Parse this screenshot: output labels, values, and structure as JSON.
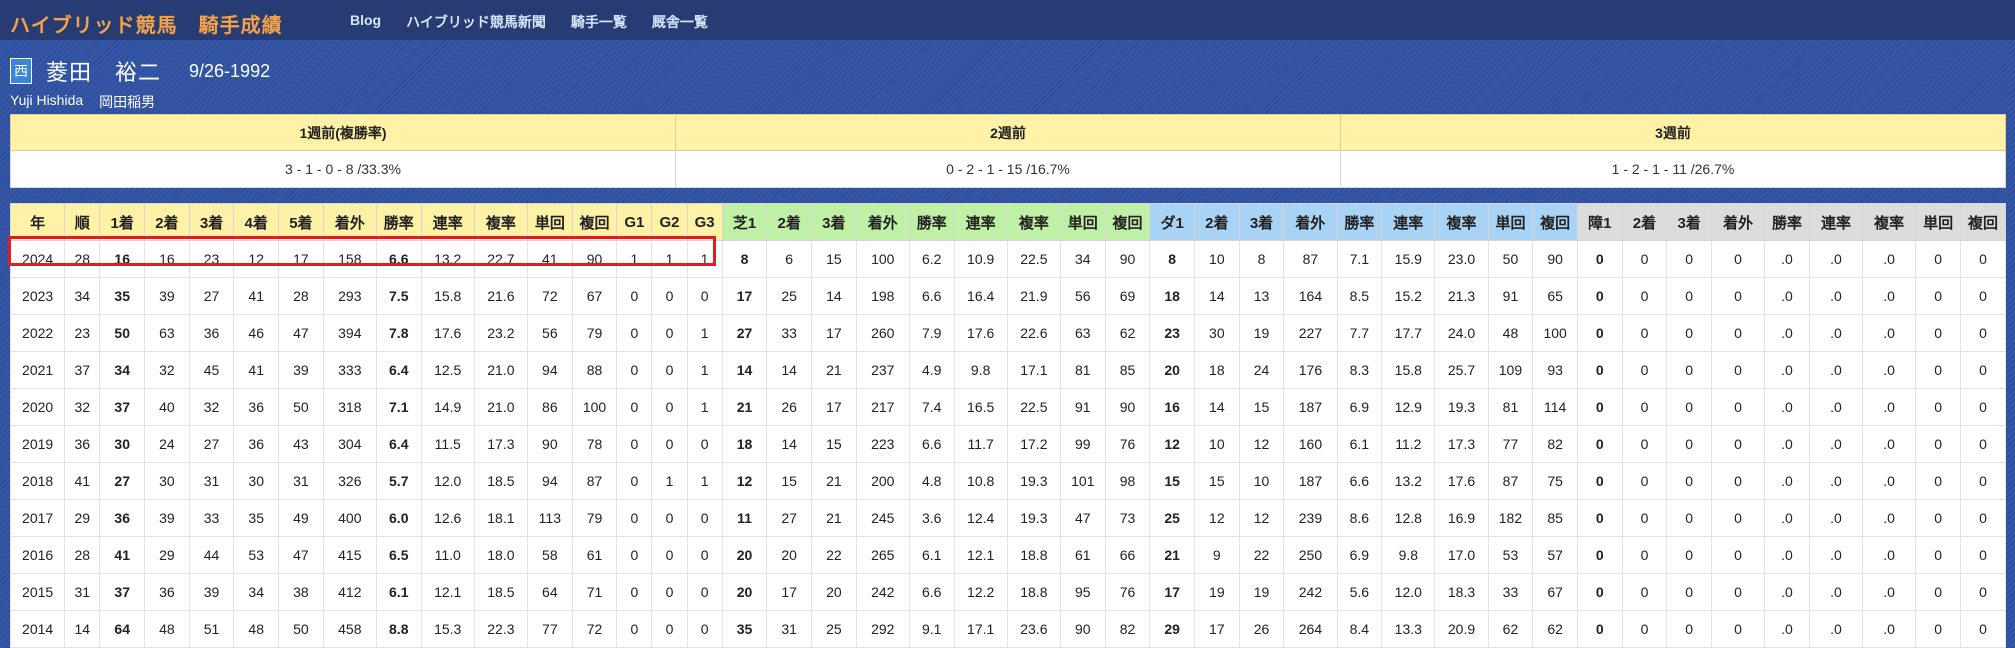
{
  "header": {
    "site_title": "ハイブリッド競馬　騎手成績",
    "nav": [
      "Blog",
      "ハイブリッド競馬新聞",
      "騎手一覧",
      "厩舎一覧"
    ]
  },
  "jockey": {
    "affiliation": "西",
    "name": "菱田　裕二",
    "dob": "9/26-1992",
    "name_en": "Yuji Hishida",
    "stable": "岡田稲男"
  },
  "weeks": {
    "headers": [
      "1週前(複勝率)",
      "2週前",
      "3週前"
    ],
    "values": [
      "3 - 1 - 0 - 8 /33.3%",
      "0 - 2 - 1 - 15 /16.7%",
      "1 - 2 - 1 - 11 /26.7%"
    ]
  },
  "stats": {
    "headers": [
      "年",
      "順",
      "1着",
      "2着",
      "3着",
      "4着",
      "5着",
      "着外",
      "勝率",
      "連率",
      "複率",
      "単回",
      "複回",
      "G1",
      "G2",
      "G3",
      "芝1",
      "2着",
      "3着",
      "着外",
      "勝率",
      "連率",
      "複率",
      "単回",
      "複回",
      "ダ1",
      "2着",
      "3着",
      "着外",
      "勝率",
      "連率",
      "複率",
      "単回",
      "複回",
      "障1",
      "2着",
      "3着",
      "着外",
      "勝率",
      "連率",
      "複率",
      "単回",
      "複回"
    ],
    "rows": [
      [
        "2024",
        "28",
        "16",
        "16",
        "23",
        "12",
        "17",
        "158",
        "6.6",
        "13.2",
        "22.7",
        "41",
        "90",
        "1",
        "1",
        "1",
        "8",
        "6",
        "15",
        "100",
        "6.2",
        "10.9",
        "22.5",
        "34",
        "90",
        "8",
        "10",
        "8",
        "87",
        "7.1",
        "15.9",
        "23.0",
        "50",
        "90",
        "0",
        "0",
        "0",
        "0",
        ".0",
        ".0",
        ".0",
        "0",
        "0"
      ],
      [
        "2023",
        "34",
        "35",
        "39",
        "27",
        "41",
        "28",
        "293",
        "7.5",
        "15.8",
        "21.6",
        "72",
        "67",
        "0",
        "0",
        "0",
        "17",
        "25",
        "14",
        "198",
        "6.6",
        "16.4",
        "21.9",
        "56",
        "69",
        "18",
        "14",
        "13",
        "164",
        "8.5",
        "15.2",
        "21.3",
        "91",
        "65",
        "0",
        "0",
        "0",
        "0",
        ".0",
        ".0",
        ".0",
        "0",
        "0"
      ],
      [
        "2022",
        "23",
        "50",
        "63",
        "36",
        "46",
        "47",
        "394",
        "7.8",
        "17.6",
        "23.2",
        "56",
        "79",
        "0",
        "0",
        "1",
        "27",
        "33",
        "17",
        "260",
        "7.9",
        "17.6",
        "22.6",
        "63",
        "62",
        "23",
        "30",
        "19",
        "227",
        "7.7",
        "17.7",
        "24.0",
        "48",
        "100",
        "0",
        "0",
        "0",
        "0",
        ".0",
        ".0",
        ".0",
        "0",
        "0"
      ],
      [
        "2021",
        "37",
        "34",
        "32",
        "45",
        "41",
        "39",
        "333",
        "6.4",
        "12.5",
        "21.0",
        "94",
        "88",
        "0",
        "0",
        "1",
        "14",
        "14",
        "21",
        "237",
        "4.9",
        "9.8",
        "17.1",
        "81",
        "85",
        "20",
        "18",
        "24",
        "176",
        "8.3",
        "15.8",
        "25.7",
        "109",
        "93",
        "0",
        "0",
        "0",
        "0",
        ".0",
        ".0",
        ".0",
        "0",
        "0"
      ],
      [
        "2020",
        "32",
        "37",
        "40",
        "32",
        "36",
        "50",
        "318",
        "7.1",
        "14.9",
        "21.0",
        "86",
        "100",
        "0",
        "0",
        "1",
        "21",
        "26",
        "17",
        "217",
        "7.4",
        "16.5",
        "22.5",
        "91",
        "90",
        "16",
        "14",
        "15",
        "187",
        "6.9",
        "12.9",
        "19.3",
        "81",
        "114",
        "0",
        "0",
        "0",
        "0",
        ".0",
        ".0",
        ".0",
        "0",
        "0"
      ],
      [
        "2019",
        "36",
        "30",
        "24",
        "27",
        "36",
        "43",
        "304",
        "6.4",
        "11.5",
        "17.3",
        "90",
        "78",
        "0",
        "0",
        "0",
        "18",
        "14",
        "15",
        "223",
        "6.6",
        "11.7",
        "17.2",
        "99",
        "76",
        "12",
        "10",
        "12",
        "160",
        "6.1",
        "11.2",
        "17.3",
        "77",
        "82",
        "0",
        "0",
        "0",
        "0",
        ".0",
        ".0",
        ".0",
        "0",
        "0"
      ],
      [
        "2018",
        "41",
        "27",
        "30",
        "31",
        "30",
        "31",
        "326",
        "5.7",
        "12.0",
        "18.5",
        "94",
        "87",
        "0",
        "1",
        "1",
        "12",
        "15",
        "21",
        "200",
        "4.8",
        "10.8",
        "19.3",
        "101",
        "98",
        "15",
        "15",
        "10",
        "187",
        "6.6",
        "13.2",
        "17.6",
        "87",
        "75",
        "0",
        "0",
        "0",
        "0",
        ".0",
        ".0",
        ".0",
        "0",
        "0"
      ],
      [
        "2017",
        "29",
        "36",
        "39",
        "33",
        "35",
        "49",
        "400",
        "6.0",
        "12.6",
        "18.1",
        "113",
        "79",
        "0",
        "0",
        "0",
        "11",
        "27",
        "21",
        "245",
        "3.6",
        "12.4",
        "19.3",
        "47",
        "73",
        "25",
        "12",
        "12",
        "239",
        "8.6",
        "12.8",
        "16.9",
        "182",
        "85",
        "0",
        "0",
        "0",
        "0",
        ".0",
        ".0",
        ".0",
        "0",
        "0"
      ],
      [
        "2016",
        "28",
        "41",
        "29",
        "44",
        "53",
        "47",
        "415",
        "6.5",
        "11.0",
        "18.0",
        "58",
        "61",
        "0",
        "0",
        "0",
        "20",
        "20",
        "22",
        "265",
        "6.1",
        "12.1",
        "18.8",
        "61",
        "66",
        "21",
        "9",
        "22",
        "250",
        "6.9",
        "9.8",
        "17.0",
        "53",
        "57",
        "0",
        "0",
        "0",
        "0",
        ".0",
        ".0",
        ".0",
        "0",
        "0"
      ],
      [
        "2015",
        "31",
        "37",
        "36",
        "39",
        "34",
        "38",
        "412",
        "6.1",
        "12.1",
        "18.5",
        "64",
        "71",
        "0",
        "0",
        "0",
        "20",
        "17",
        "20",
        "242",
        "6.6",
        "12.2",
        "18.8",
        "95",
        "76",
        "17",
        "19",
        "19",
        "242",
        "5.6",
        "12.0",
        "18.3",
        "33",
        "67",
        "0",
        "0",
        "0",
        "0",
        ".0",
        ".0",
        ".0",
        "0",
        "0"
      ],
      [
        "2014",
        "14",
        "64",
        "48",
        "51",
        "48",
        "50",
        "458",
        "8.8",
        "15.3",
        "22.3",
        "77",
        "72",
        "0",
        "0",
        "0",
        "35",
        "31",
        "25",
        "292",
        "9.1",
        "17.1",
        "23.6",
        "90",
        "82",
        "29",
        "17",
        "26",
        "264",
        "8.4",
        "13.3",
        "20.9",
        "62",
        "62",
        "0",
        "0",
        "0",
        "0",
        ".0",
        ".0",
        ".0",
        "0",
        "0"
      ]
    ]
  }
}
